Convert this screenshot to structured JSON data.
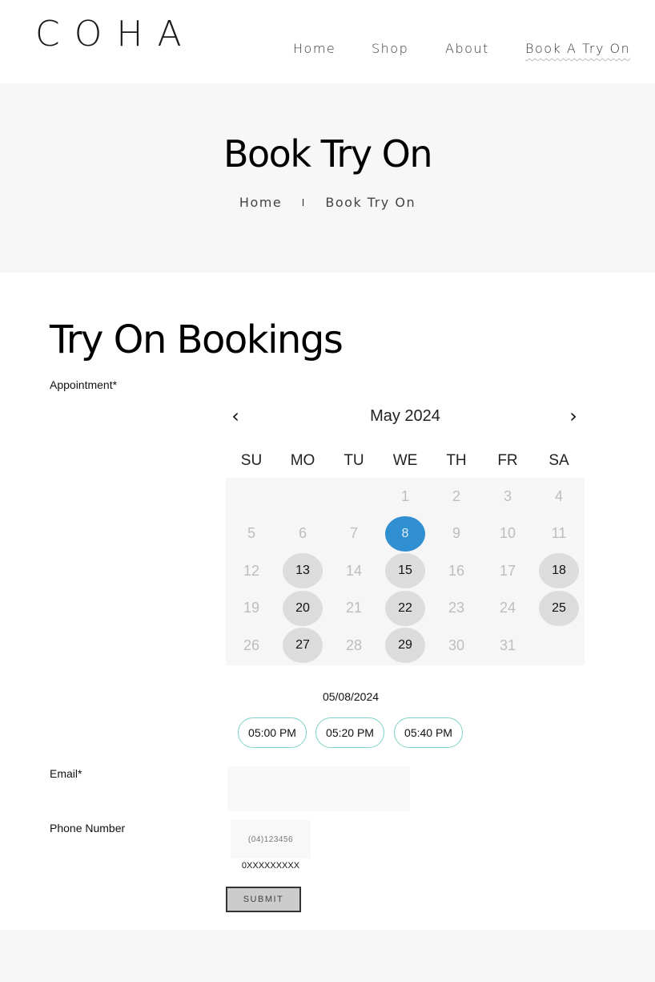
{
  "header": {
    "logo": "COHA",
    "nav": [
      {
        "label": "Home"
      },
      {
        "label": "Shop"
      },
      {
        "label": "About"
      },
      {
        "label": "Book A Try On",
        "active": true
      }
    ]
  },
  "hero": {
    "title": "Book Try On",
    "breadcrumb": {
      "home": "Home",
      "separator": "I",
      "current": "Book Try On"
    }
  },
  "main": {
    "title": "Try On Bookings",
    "appointment_label": "Appointment*",
    "calendar": {
      "prev_icon": "chevron-left-icon",
      "prev_glyph": "‹",
      "next_icon": "chevron-right-icon",
      "next_glyph": "›",
      "month_label": "May 2024",
      "weekdays": [
        "SU",
        "MO",
        "TU",
        "WE",
        "TH",
        "FR",
        "SA"
      ],
      "first_weekday_index": 3,
      "days_in_month": 31,
      "selected_day": 8,
      "available_days": [
        13,
        15,
        18,
        20,
        22,
        25,
        27,
        29
      ],
      "selected_color": "#2f8fd0",
      "available_color": "#dcdcdc"
    },
    "selected_date": "05/08/2024",
    "time_slots": [
      "05:00 PM",
      "05:20 PM",
      "05:40 PM"
    ],
    "email_label": "Email*",
    "email_value": "",
    "phone_label": "Phone Number",
    "phone_placeholder": "(04)123456",
    "phone_hint": "0XXXXXXXXX",
    "submit_label": "SUBMIT"
  }
}
